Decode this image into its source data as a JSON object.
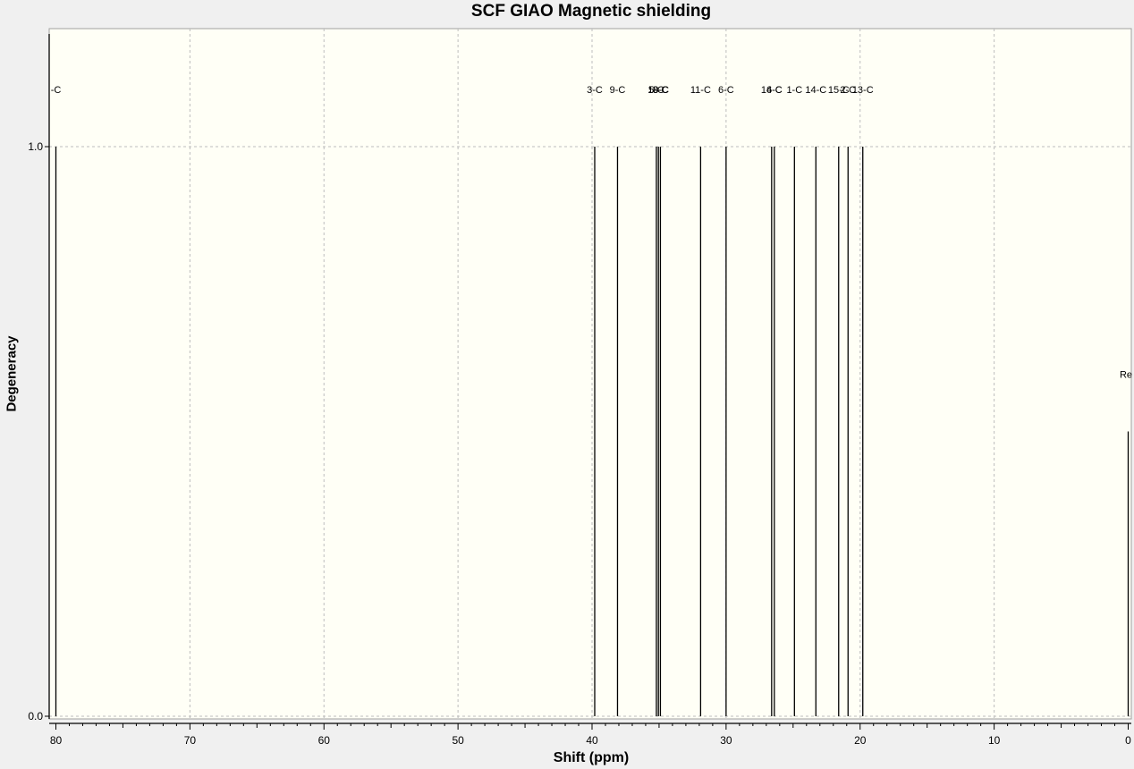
{
  "chart_data": {
    "type": "stick",
    "title": "SCF GIAO Magnetic shielding",
    "xlabel": "Shift (ppm)",
    "ylabel": "Degeneracy",
    "xlim": [
      80.5,
      -0.2
    ],
    "ylim": [
      0,
      1.2
    ],
    "x_ticks": [
      80,
      70,
      60,
      50,
      40,
      30,
      20,
      10,
      0
    ],
    "y_ticks": [
      0.0,
      1.0
    ],
    "y_tick_labels": [
      "0.0",
      "1.0"
    ],
    "grid": true,
    "peaks": [
      {
        "label": "-C",
        "x": 80.0,
        "y": 1.0
      },
      {
        "label": "3-C",
        "x": 39.8,
        "y": 1.0
      },
      {
        "label": "9-C",
        "x": 38.1,
        "y": 1.0
      },
      {
        "label": "5-C",
        "x": 35.2,
        "y": 1.0
      },
      {
        "label": "10-C",
        "x": 35.05,
        "y": 1.0
      },
      {
        "label": "8-C",
        "x": 34.9,
        "y": 1.0
      },
      {
        "label": "11-C",
        "x": 31.9,
        "y": 1.0
      },
      {
        "label": "6-C",
        "x": 30.0,
        "y": 1.0
      },
      {
        "label": "16-C",
        "x": 26.6,
        "y": 1.0
      },
      {
        "label": "4-C",
        "x": 26.4,
        "y": 1.0
      },
      {
        "label": "1-C",
        "x": 24.9,
        "y": 1.0
      },
      {
        "label": "14-C",
        "x": 23.3,
        "y": 1.0
      },
      {
        "label": "15-C",
        "x": 21.6,
        "y": 1.0
      },
      {
        "label": "2-C",
        "x": 20.9,
        "y": 1.0
      },
      {
        "label": "13-C",
        "x": 19.8,
        "y": 1.0
      },
      {
        "label": "Re",
        "x": 0.0,
        "y": 0.5
      }
    ]
  }
}
